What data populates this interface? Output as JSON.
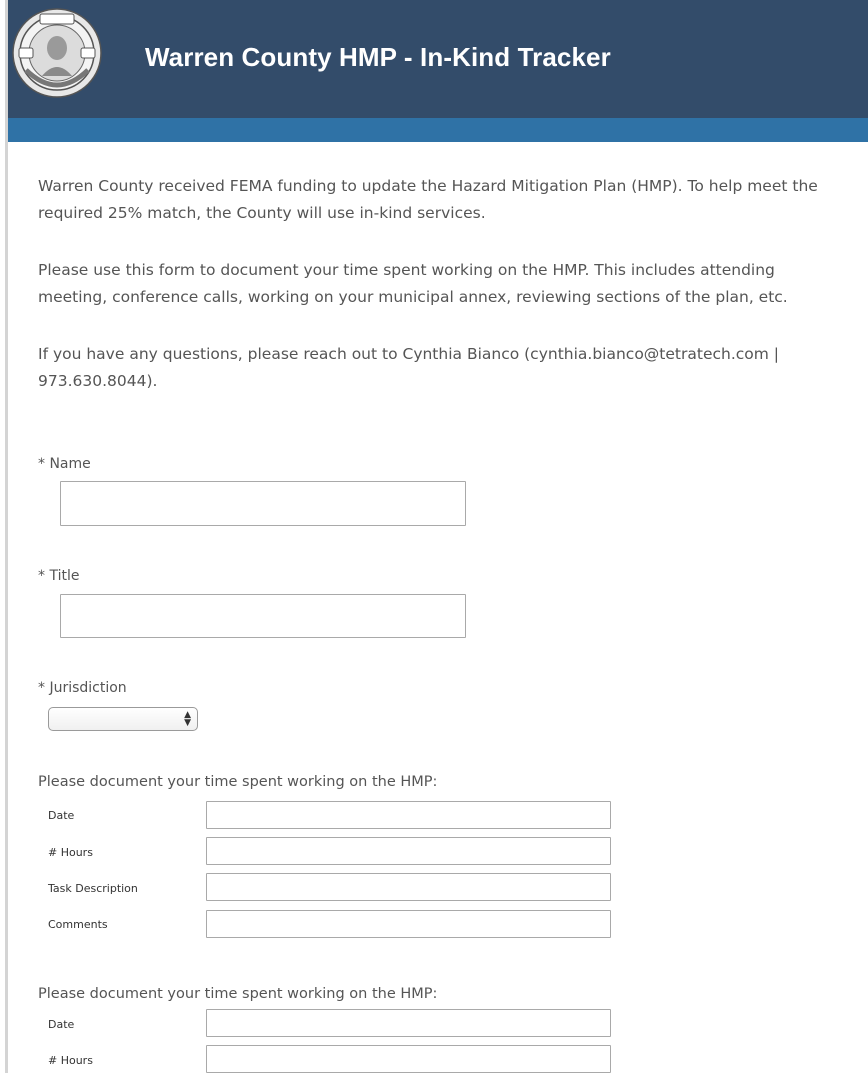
{
  "header": {
    "title": "Warren County HMP - In-Kind Tracker",
    "seal_icon": "county-seal",
    "colors": {
      "header_bg": "#334c6a",
      "band": "#2f72a6"
    }
  },
  "intro": {
    "p1": "Warren County received FEMA funding to update the Hazard Mitigation Plan (HMP). To help meet the required 25% match, the County will use in-kind services.",
    "p2": "Please use this form to document your time spent working on the HMP. This includes attending meeting, conference calls, working on your municipal annex, reviewing sections of the plan, etc.",
    "p3": "If you have any questions, please reach out to Cynthia Bianco (cynthia.bianco@tetratech.com | 973.630.8044)."
  },
  "form": {
    "name": {
      "label": "* Name",
      "value": ""
    },
    "title": {
      "label": "* Title",
      "value": ""
    },
    "jurisdiction": {
      "label": "* Jurisdiction",
      "selected": ""
    },
    "entries": [
      {
        "heading": "Please document your time spent working on the HMP:",
        "rows": [
          {
            "label": "Date",
            "value": ""
          },
          {
            "label": "# Hours",
            "value": ""
          },
          {
            "label": "Task Description",
            "value": ""
          },
          {
            "label": "Comments",
            "value": ""
          }
        ]
      },
      {
        "heading": "Please document your time spent working on the HMP:",
        "rows": [
          {
            "label": "Date",
            "value": ""
          },
          {
            "label": "# Hours",
            "value": ""
          }
        ]
      }
    ]
  }
}
